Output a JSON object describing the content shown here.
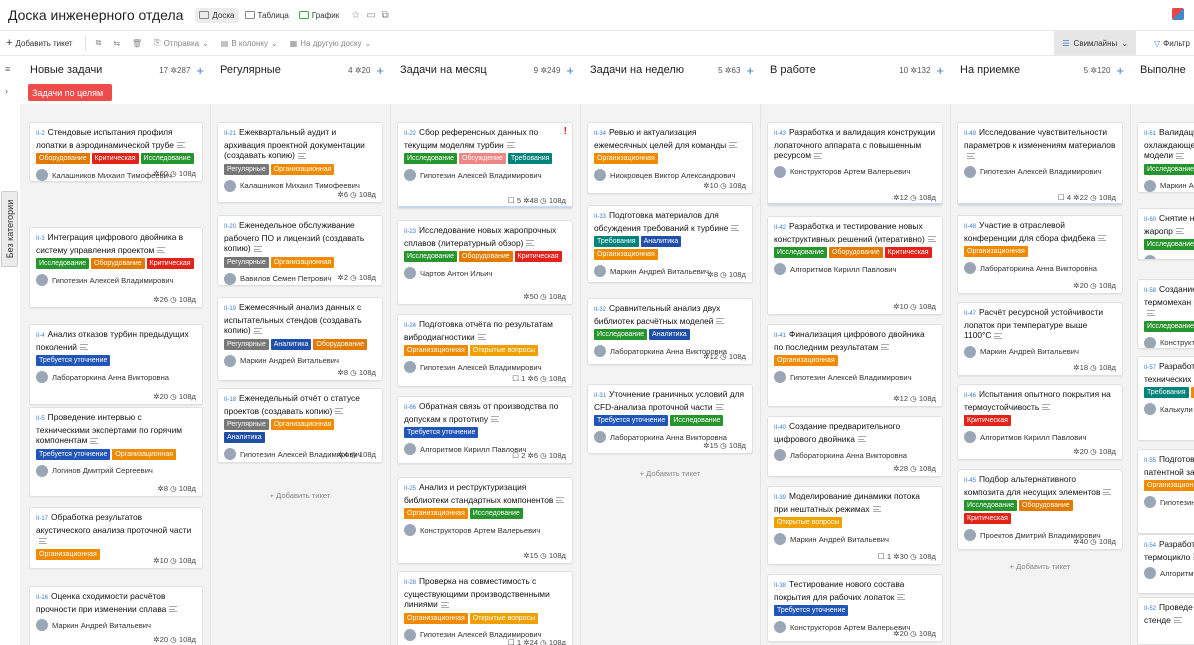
{
  "header": {
    "title": "Доска инженерного отдела",
    "views": [
      "Доска",
      "Таблица",
      "График"
    ]
  },
  "toolbar": {
    "add": "Добавить тикет",
    "send": "Отправка",
    "to_col": "В колонку",
    "to_board": "На другую доску",
    "swimlanes": "Свимлайны",
    "filter": "Фильтр"
  },
  "sidebar": {
    "category": "Без категории"
  },
  "swimlane_label": "Задачи по целям",
  "add_ticket_label": "+ Добавить тикет",
  "columns": [
    {
      "name": "Новые задачи",
      "count": "17",
      "pts": "287",
      "cards": [
        {
          "id": "II-2",
          "title": "Стендовые испытания профиля лопатки в аэродинамической трубе",
          "tags": [
            "Оборудование",
            "Критическая",
            "Исследование"
          ],
          "assignee": "Калашников Михаил Тимофеевич",
          "meta": "60  108д"
        },
        {
          "id": "II-3",
          "title": "Интеграция цифрового двойника в систему управления проектом",
          "tags": [
            "Исследование",
            "Оборудование",
            "Критическая"
          ],
          "assignee": "Гипотезин Алексей Владимирович",
          "meta": "26  108д"
        },
        {
          "id": "II-4",
          "title": "Анализ отказов турбин предыдущих поколений",
          "tags": [
            "Требуется уточнение"
          ],
          "assignee": "Лабораторкина Анна Викторовна",
          "meta": "20  108д"
        },
        {
          "id": "II-5",
          "title": "Проведение интервью с техническими экспертами по горячим компонентам",
          "tags": [
            "Требуется уточнение",
            "Организационная"
          ],
          "assignee": "Логинов Дмитрий Сергеевич",
          "meta": "8  108д"
        },
        {
          "id": "II-17",
          "title": "Обработка результатов акустического анализа проточной части",
          "tags": [
            "Организационная"
          ],
          "assignee": "",
          "meta": "10  108д"
        },
        {
          "id": "II-16",
          "title": "Оценка сходимости расчётов прочности при изменении сплава",
          "tags": [],
          "assignee": "Маркин Андрей Витальевич",
          "meta": "20  108д"
        }
      ]
    },
    {
      "name": "Регулярные",
      "count": "4",
      "pts": "20",
      "cards": [
        {
          "id": "II-21",
          "title": "Ежеквартальный аудит и архивация проектной документации (создавать копию)",
          "tags": [
            "Регулярные",
            "Организационная"
          ],
          "assignee": "Калашников Михаил Тимофеевич",
          "meta": "6  108д"
        },
        {
          "id": "II-20",
          "title": "Еженедельное обслуживание рабочего ПО и лицензий (создавать копию)",
          "tags": [
            "Регулярные",
            "Организационная"
          ],
          "assignee": "Вавилов Семен Петрович",
          "meta": "2  108д"
        },
        {
          "id": "II-19",
          "title": "Ежемесячный анализ данных с испытательных стендов (создавать копию)",
          "tags": [
            "Регулярные",
            "Аналитика",
            "Оборудование"
          ],
          "assignee": "Маркин Андрей Витальевич",
          "meta": "8  108д"
        },
        {
          "id": "II-18",
          "title": "Еженедельный отчёт о статусе проектов (создавать копию)",
          "tags": [
            "Регулярные",
            "Организационная",
            "Аналитика"
          ],
          "assignee": "Гипотезин Алексей Владимирович",
          "meta": "4  108д"
        }
      ]
    },
    {
      "name": "Задачи на месяц",
      "count": "9",
      "pts": "249",
      "cards": [
        {
          "id": "II-22",
          "title": "Сбор референсных данных по текущим моделям турбин",
          "tags": [
            "Исследование",
            "Обсуждение",
            "Требования"
          ],
          "assignee": "Гипотезин Алексей Владимирович",
          "meta": "5  48  108д"
        },
        {
          "id": "II-23",
          "title": "Исследование новых жаропрочных сплавов (литературный обзор)",
          "tags": [
            "Исследование",
            "Оборудование",
            "Критическая"
          ],
          "assignee": "Чартов Антон Ильич",
          "meta": "50  108д"
        },
        {
          "id": "II-24",
          "title": "Подготовка отчёта по результатам вибродиагностики",
          "tags": [
            "Организационная",
            "Открытые вопросы"
          ],
          "assignee": "Гипотезин Алексей Владимирович",
          "meta": "1  6  108д"
        },
        {
          "id": "II-66",
          "title": "Обратная связь от производства по допускам к прототипу",
          "tags": [
            "Требуется уточнение"
          ],
          "assignee": "Алгоритмов Кирилл Павлович",
          "meta": "2  6  108д"
        },
        {
          "id": "II-25",
          "title": "Анализ и реструктуризация библиотеки стандартных компонентов",
          "tags": [
            "Организационная",
            "Исследование"
          ],
          "assignee": "Конструкторов Артем Валерьевич",
          "meta": "15  108д"
        },
        {
          "id": "II-28",
          "title": "Проверка на совместимость с существующими производственными линиями",
          "tags": [
            "Организационная",
            "Открытые вопросы"
          ],
          "assignee": "Гипотезин Алексей Владимирович",
          "meta": "1  24  108д"
        }
      ]
    },
    {
      "name": "Задачи на неделю",
      "count": "5",
      "pts": "63",
      "cards": [
        {
          "id": "II-34",
          "title": "Ревью и актуализация ежемесячных целей для команды",
          "tags": [
            "Организационная"
          ],
          "assignee": "Ниокровцев Виктор Александрович",
          "meta": "10  108д"
        },
        {
          "id": "II-33",
          "title": "Подготовка материалов для обсуждения требований к турбине",
          "tags": [
            "Требования",
            "Аналитика",
            "Организационная"
          ],
          "assignee": "Маркин Андрей Витальевич",
          "meta": "8  108д"
        },
        {
          "id": "II-32",
          "title": "Сравнительный анализ двух библиотек расчётных моделей",
          "tags": [
            "Исследование",
            "Аналитика"
          ],
          "assignee": "Лабораторкина Анна Викторовна",
          "meta": "12  108д"
        },
        {
          "id": "II-31",
          "title": "Уточнение граничных условий для CFD-анализа проточной части",
          "tags": [
            "Требуется уточнение",
            "Исследование"
          ],
          "assignee": "Лабораторкина Анна Викторовна",
          "meta": "15  108д"
        }
      ]
    },
    {
      "name": "В работе",
      "count": "10",
      "pts": "132",
      "cards": [
        {
          "id": "II-43",
          "title": "Разработка и валидация конструкции лопаточного аппарата с повышенным ресурсом",
          "tags": [],
          "assignee": "Конструкторов Артем Валерьевич",
          "meta": "12  108д"
        },
        {
          "id": "II-42",
          "title": "Разработка и тестирование новых конструктивных решений (итеративно)",
          "tags": [
            "Исследование",
            "Оборудование",
            "Критическая"
          ],
          "assignee": "Алгоритмов Кирилл Павлович",
          "meta": "10  108д"
        },
        {
          "id": "II-41",
          "title": "Финализация цифрового двойника по последним результатам",
          "tags": [
            "Организационная"
          ],
          "assignee": "Гипотезин Алексей Владимирович",
          "meta": "12  108д"
        },
        {
          "id": "II-40",
          "title": "Создание предварительного цифрового двойника",
          "tags": [],
          "assignee": "Лабораторкина Анна Викторовна",
          "meta": "28  108д"
        },
        {
          "id": "II-39",
          "title": "Моделирование динамики потока при нештатных режимах",
          "tags": [
            "Открытые вопросы"
          ],
          "assignee": "Маркин Андрей Витальевич",
          "meta": "1  30  108д"
        },
        {
          "id": "II-38",
          "title": "Тестирование нового состава покрытия для рабочих лопаток",
          "tags": [
            "Требуется уточнение"
          ],
          "assignee": "Конструкторов Артем Валерьевич",
          "meta": "20  108д"
        }
      ]
    },
    {
      "name": "На приемке",
      "count": "5",
      "pts": "120",
      "cards": [
        {
          "id": "II-49",
          "title": "Исследование чувствительности параметров к изменениям материалов",
          "tags": [],
          "assignee": "Гипотезин Алексей Владимирович",
          "meta": "4  22  108д"
        },
        {
          "id": "II-48",
          "title": "Участие в отраслевой конференции для сбора фидбека",
          "tags": [
            "Организационная"
          ],
          "assignee": "Лабораторкина Анна Викторовна",
          "meta": "20  108д"
        },
        {
          "id": "II-47",
          "title": "Расчёт ресурсной устойчивости лопаток при температуре выше 1100°C",
          "tags": [],
          "assignee": "Маркин Андрей Витальевич",
          "meta": "18  108д"
        },
        {
          "id": "II-46",
          "title": "Испытания опытного покрытия на термоустойчивость",
          "tags": [
            "Критическая"
          ],
          "assignee": "Алгоритмов Кирилл Павлович",
          "meta": "20  108д"
        },
        {
          "id": "II-45",
          "title": "Подбор альтернативного композита для несущих элементов",
          "tags": [
            "Исследование",
            "Оборудование",
            "Критическая"
          ],
          "assignee": "Проектов Дмитрий Владимирович",
          "meta": "40  108д"
        }
      ]
    },
    {
      "name": "Выполне",
      "count": "",
      "pts": "",
      "cards": [
        {
          "id": "II-61",
          "title": "Валидация охлаждающего CFD-модели",
          "tags": [
            "Исследование"
          ],
          "assignee": "Маркин А",
          "meta": ""
        },
        {
          "id": "II-60",
          "title": "Снятие нового жаропр",
          "tags": [
            "Исследование"
          ],
          "assignee": "Технолог",
          "meta": ""
        },
        {
          "id": "II-58",
          "title": "Создание термомехан ротора",
          "tags": [
            "Исследование"
          ],
          "assignee": "Конструкт",
          "meta": ""
        },
        {
          "id": "II-57",
          "title": "Разработ технических",
          "tags": [
            "Требования",
            "Ор"
          ],
          "assignee": "Калькули",
          "meta": ""
        },
        {
          "id": "II-55",
          "title": "Подготов патентной за",
          "tags": [
            "Организацион"
          ],
          "assignee": "Гипотезин",
          "meta": ""
        },
        {
          "id": "II-54",
          "title": "Разработ термоцикло",
          "tags": [],
          "assignee": "Алгоритм",
          "meta": ""
        },
        {
          "id": "II-52",
          "title": "Проведе на стенде",
          "tags": [],
          "assignee": "",
          "meta": ""
        }
      ]
    }
  ]
}
